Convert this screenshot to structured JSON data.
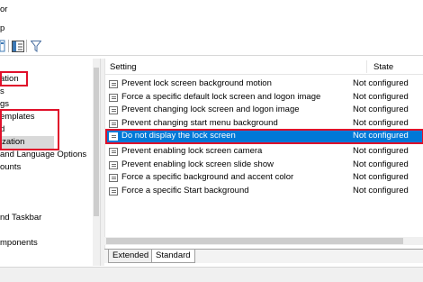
{
  "menu": {
    "top_label": "or",
    "bottom_label": "p"
  },
  "toolbar": {
    "buttons": [
      "properties-icon",
      "show-hide-tree-icon",
      "filter-icon"
    ]
  },
  "tree": {
    "items": [
      {
        "label": "ation"
      },
      {
        "label": "s"
      },
      {
        "label": "gs"
      },
      {
        "label": "emplates"
      },
      {
        "label": "d"
      },
      {
        "label": "ization",
        "selected": true
      },
      {
        "label": "and Language Options"
      },
      {
        "label": "ounts"
      },
      {
        "label": ""
      },
      {
        "label": ""
      },
      {
        "label": "nd Taskbar"
      },
      {
        "label": ""
      },
      {
        "label": "mponents"
      }
    ]
  },
  "table": {
    "columns": {
      "setting": "Setting",
      "state": "State"
    },
    "rows": [
      {
        "setting": "Prevent lock screen background motion",
        "state": "Not configured"
      },
      {
        "setting": "Force a specific default lock screen and logon image",
        "state": "Not configured"
      },
      {
        "setting": "Prevent changing lock screen and logon image",
        "state": "Not configured"
      },
      {
        "setting": "Prevent changing start menu background",
        "state": "Not configured"
      },
      {
        "setting": "Do not display the lock screen",
        "state": "Not configured",
        "selected": true
      },
      {
        "setting": "Prevent enabling lock screen camera",
        "state": "Not configured"
      },
      {
        "setting": "Prevent enabling lock screen slide show",
        "state": "Not configured"
      },
      {
        "setting": "Force a specific background and accent color",
        "state": "Not configured"
      },
      {
        "setting": "Force a specific Start background",
        "state": "Not configured"
      }
    ]
  },
  "tabs": [
    {
      "label": "Extended"
    },
    {
      "label": "Standard",
      "active": true
    }
  ],
  "colors": {
    "selection": "#0078d7",
    "highlight_box": "#e0102a",
    "tree_selected": "#d9d9d9"
  }
}
